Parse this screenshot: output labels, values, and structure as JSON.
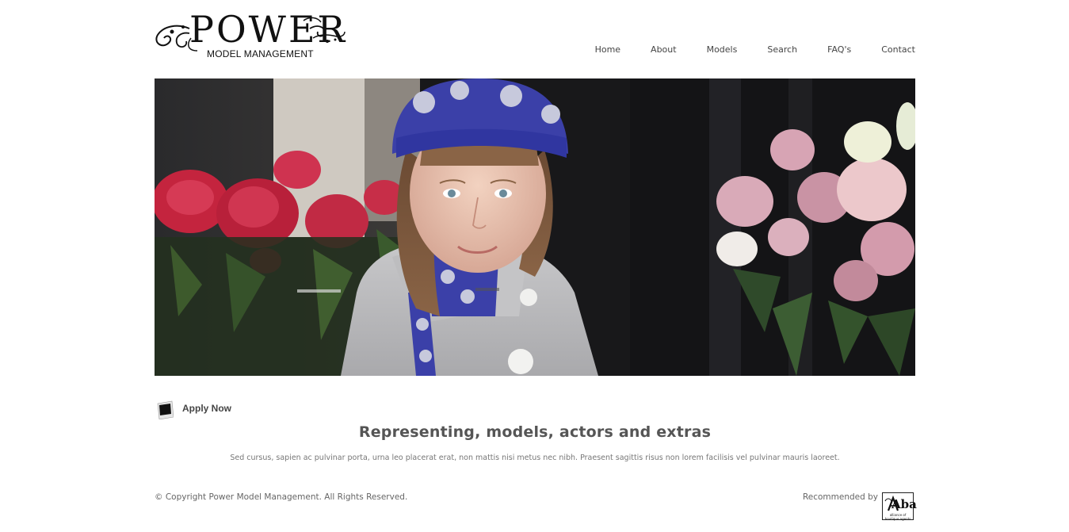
{
  "header": {
    "logo_word": "POWER",
    "logo_sub": "MODEL MANAGEMENT"
  },
  "nav": {
    "items": [
      {
        "label": "Home"
      },
      {
        "label": "About"
      },
      {
        "label": "Models"
      },
      {
        "label": "Search"
      },
      {
        "label": "FAQ's"
      },
      {
        "label": "Contact"
      }
    ]
  },
  "main": {
    "apply_label": "Apply Now",
    "headline": "Representing, models, actors and extras",
    "paragraph": "Sed cursus, sapien ac pulvinar porta, urna leo placerat erat, non mattis nisi metus nec nibh. Praesent sagittis risus non lorem facilisis vel pulvinar mauris laoreet."
  },
  "footer": {
    "copyright": "© Copyright Power Model Management. All Rights Reserved.",
    "recommended": "Recommended by",
    "badge_text": "Aba",
    "badge_sub": "alliance of boutique agents"
  },
  "colors": {
    "text": "#444444",
    "hat_blue": "#3b40a8",
    "coat_grey": "#b7b7b9",
    "peony_red": "#c4243e",
    "rose_pink": "#d9aab8"
  }
}
